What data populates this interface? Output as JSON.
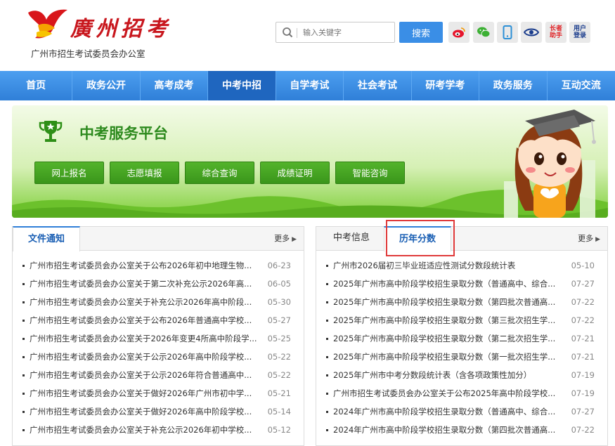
{
  "header": {
    "logo_title": "廣州招考",
    "logo_subtitle": "广州市招生考试委员会办公室",
    "search_placeholder": "输入关键字",
    "search_button": "搜索",
    "icons": [
      "weibo-icon",
      "wechat-icon",
      "mobile-icon",
      "eye-icon",
      "elder-helper-icon",
      "user-login-icon"
    ],
    "elder_helper_label": "长者\n助手",
    "user_login_label": "用户\n登录"
  },
  "nav": {
    "items": [
      "首页",
      "政务公开",
      "高考成考",
      "中考中招",
      "自学考试",
      "社会考试",
      "研考学考",
      "政务服务",
      "互动交流"
    ],
    "active": "中考中招"
  },
  "banner": {
    "title": "中考服务平台",
    "buttons": [
      "网上报名",
      "志愿填报",
      "综合查询",
      "成绩证明",
      "智能咨询"
    ]
  },
  "left_panel": {
    "tab": "文件通知",
    "more": "更多",
    "items": [
      {
        "title": "广州市招生考试委员会办公室关于公布2026年初中地理生物...",
        "date": "06-23"
      },
      {
        "title": "广州市招生考试委员会办公室关于第二次补充公示2026年高...",
        "date": "06-05"
      },
      {
        "title": "广州市招生考试委员会办公室关于补充公示2026年高中阶段...",
        "date": "05-30"
      },
      {
        "title": "广州市招生考试委员会办公室关于公布2026年普通高中学校...",
        "date": "05-27"
      },
      {
        "title": "广州市招生考试委员会办公室关于2026年变更4所高中阶段学...",
        "date": "05-25"
      },
      {
        "title": "广州市招生考试委员会办公室关于公示2026年高中阶段学校...",
        "date": "05-22"
      },
      {
        "title": "广州市招生考试委员会办公室关于公示2026年符合普通高中...",
        "date": "05-22"
      },
      {
        "title": "广州市招生考试委员会办公室关于做好2026年广州市初中学...",
        "date": "05-21"
      },
      {
        "title": "广州市招生考试委员会办公室关于做好2026年高中阶段学校...",
        "date": "05-14"
      },
      {
        "title": "广州市招生考试委员会办公室关于补充公示2026年初中学校...",
        "date": "05-12"
      }
    ]
  },
  "right_panel": {
    "tabs": [
      "中考信息",
      "历年分数"
    ],
    "active_tab": "历年分数",
    "more": "更多",
    "items": [
      {
        "title": "广州市2026届初三毕业班适应性测试分数段统计表",
        "date": "05-10"
      },
      {
        "title": "2025年广州市高中阶段学校招生录取分数（普通高中、综合...",
        "date": "07-27"
      },
      {
        "title": "2025年广州市高中阶段学校招生录取分数（第四批次普通高...",
        "date": "07-22"
      },
      {
        "title": "2025年广州市高中阶段学校招生录取分数（第三批次招生学...",
        "date": "07-22"
      },
      {
        "title": "2025年广州市高中阶段学校招生录取分数（第二批次招生学...",
        "date": "07-21"
      },
      {
        "title": "2025年广州市高中阶段学校招生录取分数（第一批次招生学...",
        "date": "07-21"
      },
      {
        "title": "2025年广州市中考分数段统计表（含各项政策性加分）",
        "date": "07-19"
      },
      {
        "title": "广州市招生考试委员会办公室关于公布2025年高中阶段学校...",
        "date": "07-19"
      },
      {
        "title": "2024年广州市高中阶段学校招生录取分数（普通高中、综合...",
        "date": "07-27"
      },
      {
        "title": "2024年广州市高中阶段学校招生录取分数（第四批次普通高...",
        "date": "07-22"
      }
    ]
  }
}
